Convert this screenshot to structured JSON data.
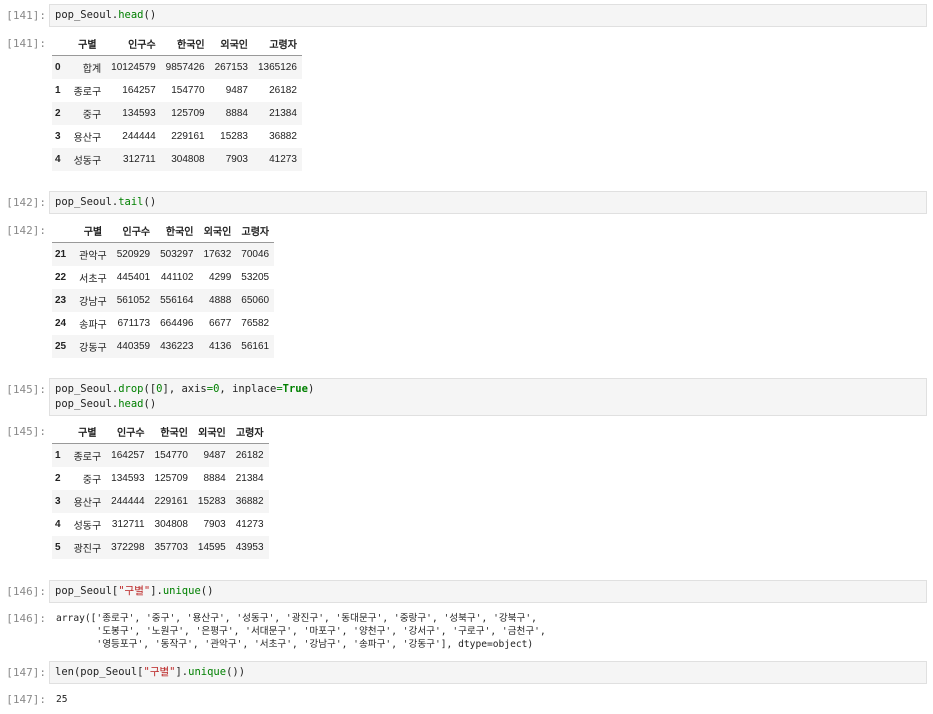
{
  "cells": [
    {
      "in_prompt": "[141]:",
      "out_prompt": "[141]:",
      "code": [
        {
          "parts": [
            {
              "t": "pop_Seoul."
            },
            {
              "t": "head",
              "c": "num"
            },
            {
              "t": "()"
            }
          ]
        }
      ],
      "table": {
        "columns": [
          "구별",
          "인구수",
          "한국인",
          "외국인",
          "고령자"
        ],
        "rows": [
          {
            "index": "0",
            "cells": [
              "합계",
              "10124579",
              "9857426",
              "267153",
              "1365126"
            ]
          },
          {
            "index": "1",
            "cells": [
              "종로구",
              "164257",
              "154770",
              "9487",
              "26182"
            ]
          },
          {
            "index": "2",
            "cells": [
              "중구",
              "134593",
              "125709",
              "8884",
              "21384"
            ]
          },
          {
            "index": "3",
            "cells": [
              "용산구",
              "244444",
              "229161",
              "15283",
              "36882"
            ]
          },
          {
            "index": "4",
            "cells": [
              "성동구",
              "312711",
              "304808",
              "7903",
              "41273"
            ]
          }
        ]
      }
    },
    {
      "in_prompt": "[142]:",
      "out_prompt": "[142]:",
      "code": [
        {
          "parts": [
            {
              "t": "pop_Seoul."
            },
            {
              "t": "tail",
              "c": "num"
            },
            {
              "t": "()"
            }
          ]
        }
      ],
      "table": {
        "columns": [
          "구별",
          "인구수",
          "한국인",
          "외국인",
          "고령자"
        ],
        "rows": [
          {
            "index": "21",
            "cells": [
              "관악구",
              "520929",
              "503297",
              "17632",
              "70046"
            ]
          },
          {
            "index": "22",
            "cells": [
              "서초구",
              "445401",
              "441102",
              "4299",
              "53205"
            ]
          },
          {
            "index": "23",
            "cells": [
              "강남구",
              "561052",
              "556164",
              "4888",
              "65060"
            ]
          },
          {
            "index": "24",
            "cells": [
              "송파구",
              "671173",
              "664496",
              "6677",
              "76582"
            ]
          },
          {
            "index": "25",
            "cells": [
              "강동구",
              "440359",
              "436223",
              "4136",
              "56161"
            ]
          }
        ]
      }
    },
    {
      "in_prompt": "[145]:",
      "out_prompt": "[145]:",
      "code": [
        {
          "parts": [
            {
              "t": "pop_Seoul."
            },
            {
              "t": "drop",
              "c": "num"
            },
            {
              "t": "(["
            },
            {
              "t": "0",
              "c": "num"
            },
            {
              "t": "], axis"
            },
            {
              "t": "=",
              "c": "num"
            },
            {
              "t": "0",
              "c": "num"
            },
            {
              "t": ", inplace"
            },
            {
              "t": "=",
              "c": "num"
            },
            {
              "t": "True",
              "c": "kw"
            },
            {
              "t": ")"
            }
          ]
        },
        {
          "parts": [
            {
              "t": "pop_Seoul."
            },
            {
              "t": "head",
              "c": "num"
            },
            {
              "t": "()"
            }
          ]
        }
      ],
      "table": {
        "columns": [
          "구별",
          "인구수",
          "한국인",
          "외국인",
          "고령자"
        ],
        "rows": [
          {
            "index": "1",
            "cells": [
              "종로구",
              "164257",
              "154770",
              "9487",
              "26182"
            ]
          },
          {
            "index": "2",
            "cells": [
              "중구",
              "134593",
              "125709",
              "8884",
              "21384"
            ]
          },
          {
            "index": "3",
            "cells": [
              "용산구",
              "244444",
              "229161",
              "15283",
              "36882"
            ]
          },
          {
            "index": "4",
            "cells": [
              "성동구",
              "312711",
              "304808",
              "7903",
              "41273"
            ]
          },
          {
            "index": "5",
            "cells": [
              "광진구",
              "372298",
              "357703",
              "14595",
              "43953"
            ]
          }
        ]
      }
    },
    {
      "in_prompt": "[146]:",
      "out_prompt": "[146]:",
      "code": [
        {
          "parts": [
            {
              "t": "pop_Seoul["
            },
            {
              "t": "\"구별\"",
              "c": "str"
            },
            {
              "t": "]."
            },
            {
              "t": "unique",
              "c": "num"
            },
            {
              "t": "()"
            }
          ]
        }
      ],
      "text": "array(['종로구', '중구', '용산구', '성동구', '광진구', '동대문구', '중랑구', '성북구', '강북구',\n       '도봉구', '노원구', '은평구', '서대문구', '마포구', '양천구', '강서구', '구로구', '금천구',\n       '영등포구', '동작구', '관악구', '서초구', '강남구', '송파구', '강동구'], dtype=object)"
    },
    {
      "in_prompt": "[147]:",
      "out_prompt": "[147]:",
      "code": [
        {
          "parts": [
            {
              "t": "len(pop_Seoul["
            },
            {
              "t": "\"구별\"",
              "c": "str"
            },
            {
              "t": "]."
            },
            {
              "t": "unique",
              "c": "num"
            },
            {
              "t": "())"
            }
          ]
        }
      ],
      "text": "25"
    }
  ]
}
